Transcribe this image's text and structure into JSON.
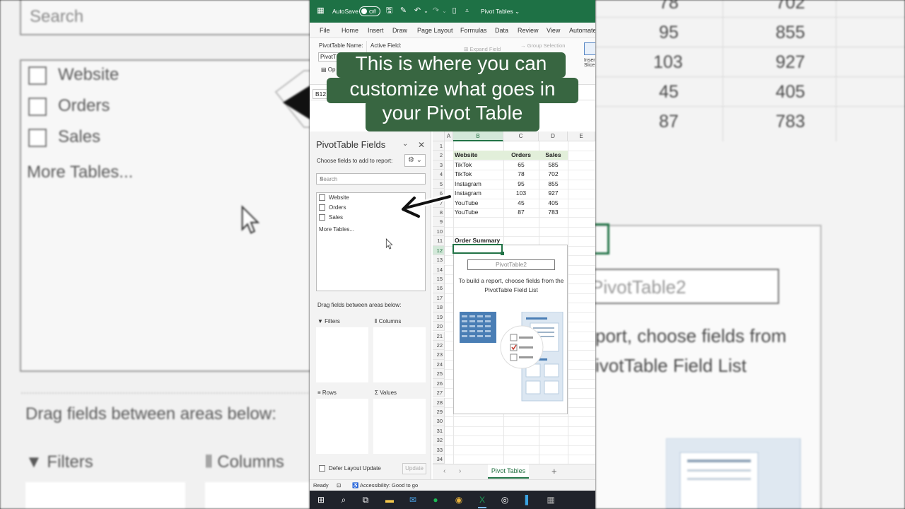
{
  "background": {
    "search_placeholder": "Search",
    "fields": [
      "Website",
      "Orders",
      "Sales"
    ],
    "more_tables": "More Tables...",
    "drag_text": "Drag fields between areas below:",
    "filters": "Filters",
    "columns": "Columns",
    "right_values": [
      [
        "78",
        "702"
      ],
      [
        "95",
        "855"
      ],
      [
        "103",
        "927"
      ],
      [
        "45",
        "405"
      ],
      [
        "87",
        "783"
      ]
    ],
    "right_pivot_name": "PivotTable2",
    "right_msg1": "port, choose fields from",
    "right_msg2": "ivotTable Field List"
  },
  "titlebar": {
    "autosave_label": "AutoSave",
    "autosave_state": "Off",
    "doc_title": "Pivot Tables"
  },
  "menu": [
    "File",
    "Home",
    "Insert",
    "Draw",
    "Page Layout",
    "Formulas",
    "Data",
    "Review",
    "View",
    "Automate"
  ],
  "ribbon": {
    "pt_name_label": "PivotTable Name:",
    "pt_name_value": "PivotT",
    "active_field_label": "Active Field:",
    "expand_field": "Expand Field",
    "group_selection": "Group Selection",
    "options": "Op",
    "insert": "Inser",
    "slicer": "Slice"
  },
  "namebox": "B12",
  "pane": {
    "title": "PivotTable Fields",
    "choose": "Choose fields to add to report:",
    "search_placeholder": "Search",
    "fields": [
      "Website",
      "Orders",
      "Sales"
    ],
    "more_tables": "More Tables...",
    "drag_text": "Drag fields between areas below:",
    "areas": {
      "filters": "Filters",
      "columns": "Columns",
      "rows": "Rows",
      "values": "Values"
    },
    "defer": "Defer Layout Update",
    "update": "Update"
  },
  "sheet": {
    "columns": [
      "A",
      "B",
      "C",
      "D",
      "E"
    ],
    "rows": [
      "1",
      "2",
      "3",
      "4",
      "5",
      "6",
      "7",
      "8",
      "9",
      "10",
      "11",
      "12",
      "13",
      "14",
      "15",
      "16",
      "17",
      "18",
      "19",
      "20",
      "21",
      "22",
      "23",
      "24",
      "25",
      "26",
      "27",
      "28",
      "29",
      "30",
      "31",
      "32",
      "33",
      "34"
    ],
    "headers": [
      "Website",
      "Orders",
      "Sales"
    ],
    "data": [
      [
        "TikTok",
        "65",
        "585"
      ],
      [
        "TikTok",
        "78",
        "702"
      ],
      [
        "Instagram",
        "95",
        "855"
      ],
      [
        "Instagram",
        "103",
        "927"
      ],
      [
        "YouTube",
        "45",
        "405"
      ],
      [
        "YouTube",
        "87",
        "783"
      ]
    ],
    "summary_label": "Order Summary",
    "pivot_name": "PivotTable2",
    "pivot_msg": "To build a report, choose fields from the PivotTable Field List",
    "tab_name": "Pivot Tables"
  },
  "status": {
    "ready": "Ready",
    "accessibility": "Accessibility: Good to go"
  },
  "caption": {
    "line1": "This is where you can",
    "line2": "customize what goes in",
    "line3": "your Pivot Table"
  },
  "colors": {
    "excel_green": "#1e7145",
    "caption_bg": "#386641",
    "header_fill": "#e2efda"
  }
}
